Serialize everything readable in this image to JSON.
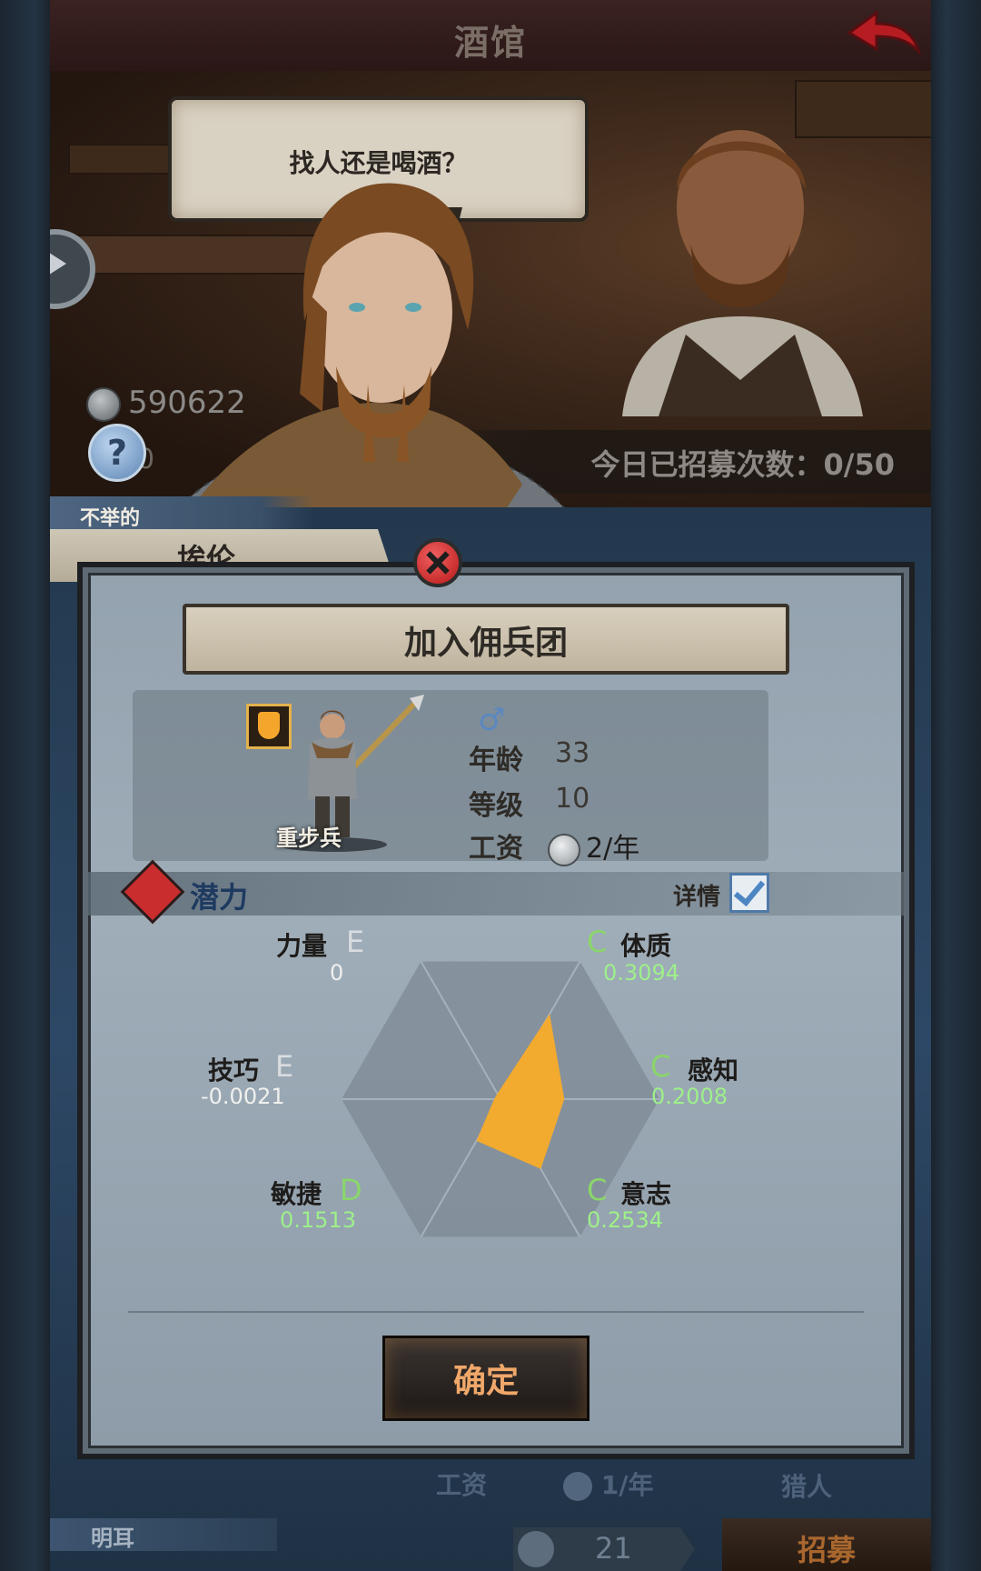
{
  "header": {
    "title": "酒馆"
  },
  "dialog": {
    "bubble_text": "找人还是喝酒？"
  },
  "resources": {
    "coins": "590622",
    "help_behind": "0"
  },
  "recruit": {
    "count_text": "今日已招募次数：0/50"
  },
  "hero": {
    "trait": "不举的",
    "name": "埃伦",
    "role": "重步兵",
    "gender_icon": "male-icon",
    "age_label": "年龄",
    "age": "33",
    "level_label": "等级",
    "level": "10",
    "wage_label": "工资",
    "wage": "2/年"
  },
  "panel": {
    "title": "加入佣兵团",
    "potential_label": "潜力",
    "detail_label": "详情",
    "detail_checked": true,
    "confirm_label": "确定"
  },
  "attributes": [
    {
      "name": "力量",
      "grade": "E",
      "value": "0",
      "potential": 0.0
    },
    {
      "name": "体质",
      "grade": "C",
      "value": "0.3094",
      "potential": 0.3094
    },
    {
      "name": "感知",
      "grade": "C",
      "value": "0.2008",
      "potential": 0.2008
    },
    {
      "name": "意志",
      "grade": "C",
      "value": "0.2534",
      "potential": 0.2534
    },
    {
      "name": "敏捷",
      "grade": "D",
      "value": "0.1513",
      "potential": 0.1513
    },
    {
      "name": "技巧",
      "grade": "E",
      "value": "-0.0021",
      "potential": -0.0021
    }
  ],
  "behind": {
    "wage_label": "工资",
    "wage_value": "1/年",
    "class": "猎人",
    "name": "明耳",
    "price": "21",
    "recruit_label": "招募"
  },
  "colors": {
    "radar_fill": "#f2aa2f",
    "grade_c": "#8ad66a",
    "value_green": "#9ef08a",
    "confirm_text": "#f0a86a"
  }
}
